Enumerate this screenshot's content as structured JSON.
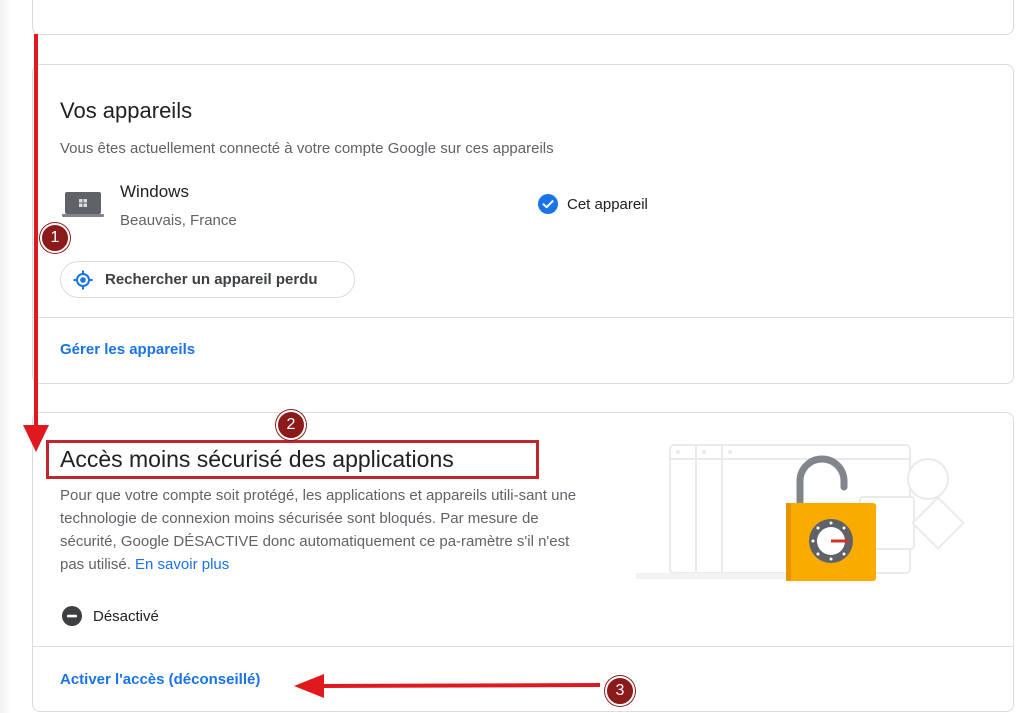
{
  "devices_card": {
    "title": "Vos appareils",
    "description": "Vous êtes actuellement connecté à votre compte Google sur ces appareils",
    "device": {
      "name": "Windows",
      "location": "Beauvais, France",
      "icon": "laptop-windows-icon",
      "status_label": "Cet appareil",
      "status_icon": "check-circle-icon"
    },
    "find_device_label": "Rechercher un appareil perdu",
    "find_device_icon": "locate-icon",
    "manage_link": "Gérer les appareils"
  },
  "lsa_card": {
    "title": "Accès moins sécurisé des applications",
    "description": "Pour que votre compte soit protégé, les applications et appareils utili-sant une technologie de connexion moins sécurisée sont bloqués. Par mesure de sécurité, Google DÉSACTIVE donc automatiquement ce pa-ramètre s'il n'est pas utilisé.",
    "learn_more": "En savoir plus",
    "status_label": "Désactivé",
    "status_icon": "minus-circle-icon",
    "illustration_icon": "padlock-illustration",
    "enable_link": "Activer l'accès (déconseillé)"
  },
  "annotations": {
    "badge_1": "1",
    "badge_2": "2",
    "badge_3": "3"
  },
  "colors": {
    "link": "#1a73e8",
    "annotation_red": "#e0191f",
    "badge": "#8b1a1a",
    "lock_orange": "#f9ab00"
  }
}
